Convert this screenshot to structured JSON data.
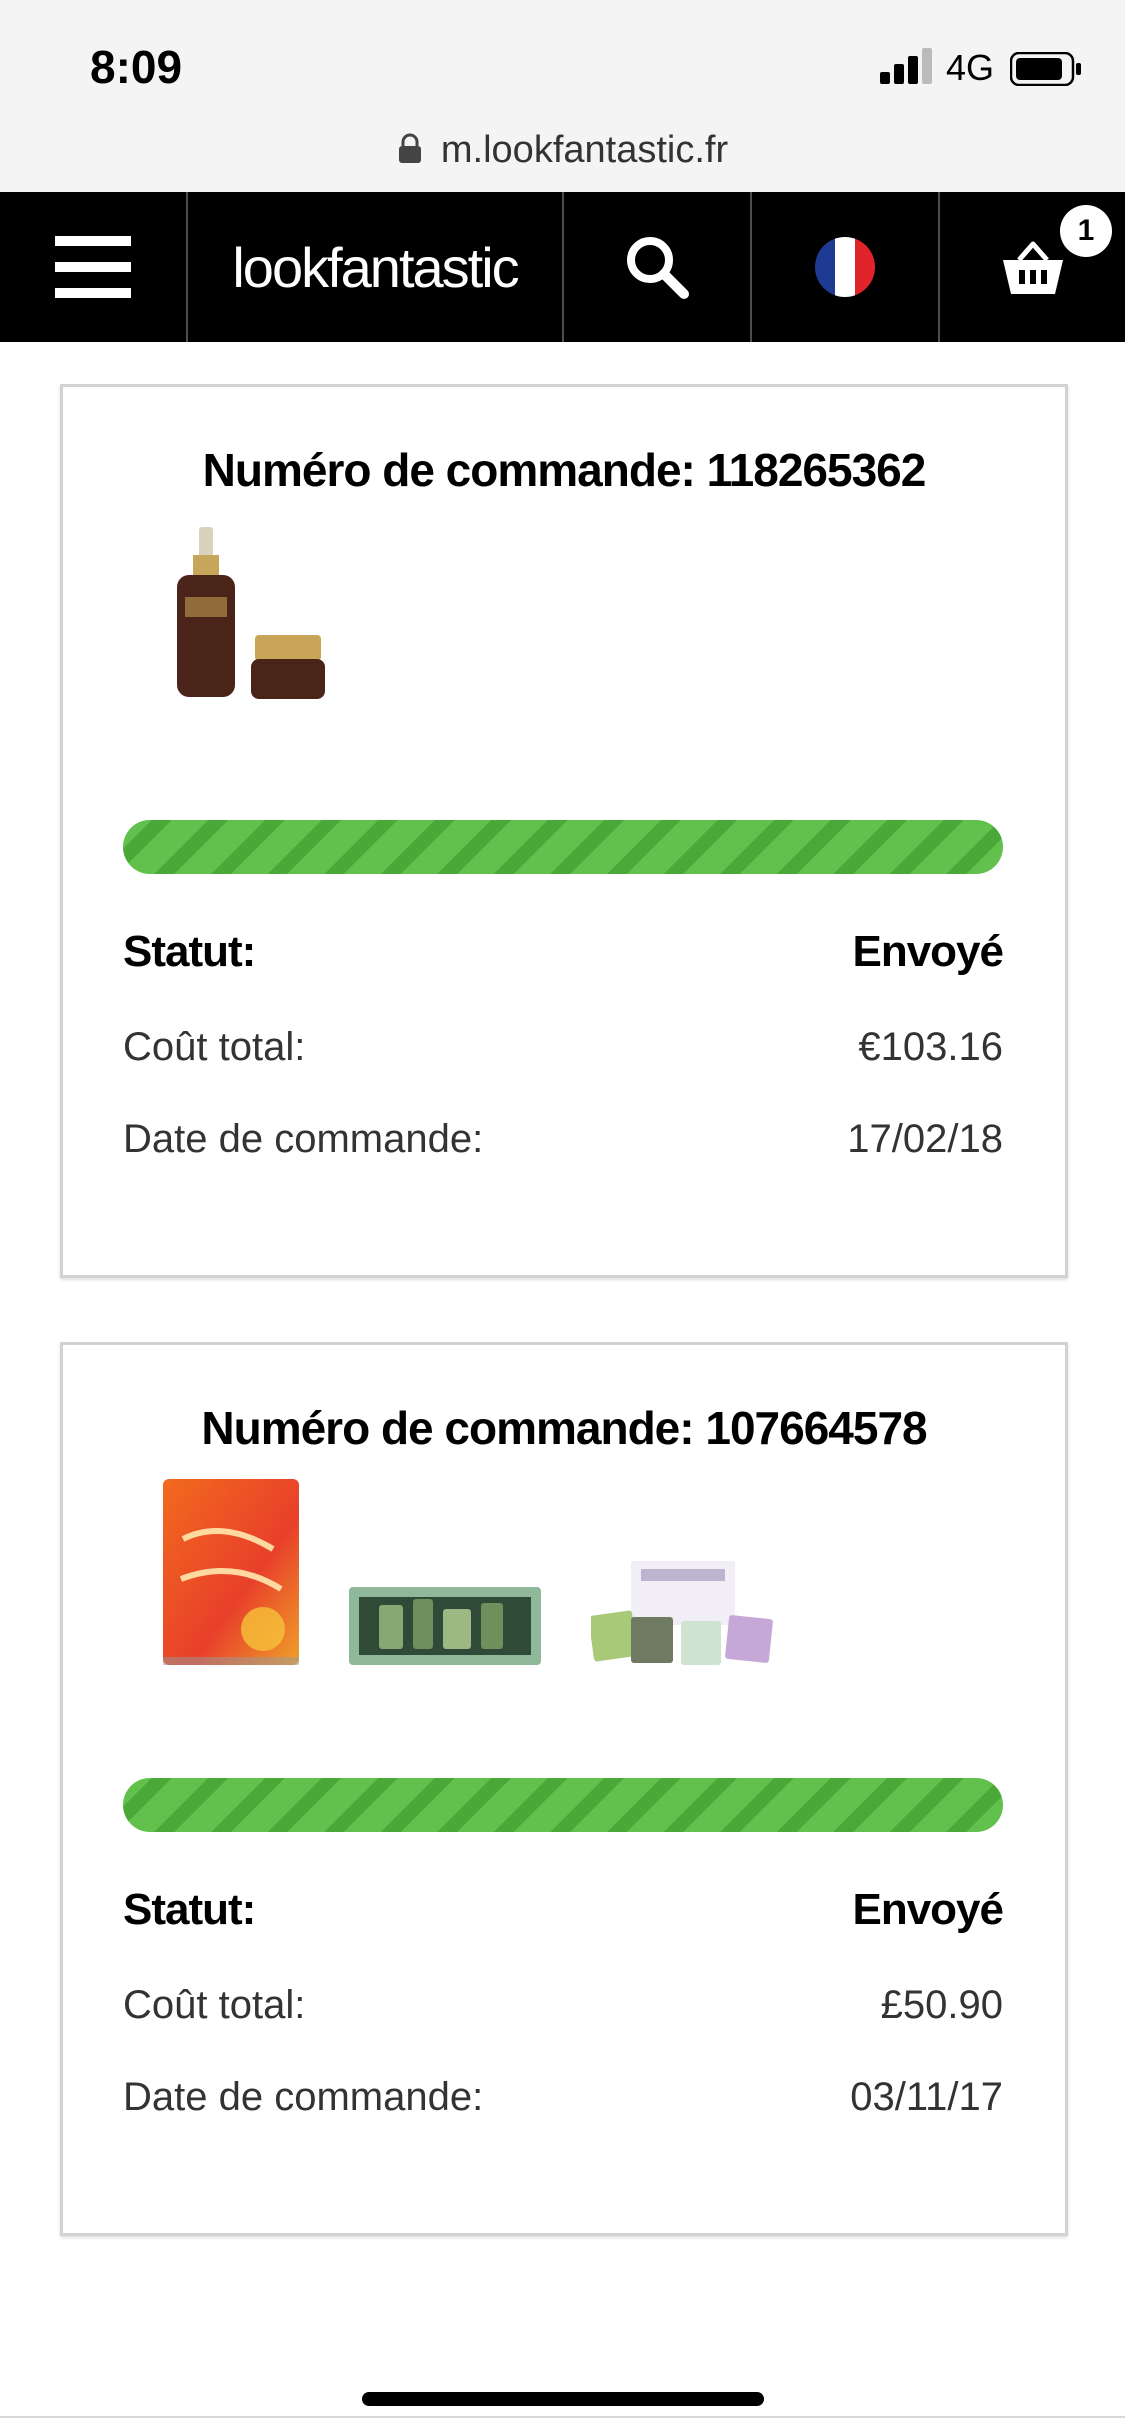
{
  "status_bar": {
    "time": "8:09",
    "network": "4G",
    "url": "m.lookfantastic.fr"
  },
  "header": {
    "logo_text": "lookfantastic",
    "basket_count": "1",
    "icons": [
      "menu-icon",
      "search-icon",
      "france-flag-icon",
      "basket-icon"
    ]
  },
  "orders": [
    {
      "title": "Numéro de commande: 118265362",
      "products": [
        "serum-bottle-and-eye-cream",
        "",
        ""
      ],
      "progress": 1.0,
      "status_label": "Statut:",
      "status_value": "Envoyé",
      "total_label": "Coût total:",
      "total_value": "€103.16",
      "date_label": "Date de commande:",
      "date_value": "17/02/18"
    },
    {
      "title": "Numéro de commande: 107664578",
      "products": [
        "flower-fusion-mask",
        "gift-set-box",
        "sheet-mask-set"
      ],
      "progress": 1.0,
      "status_label": "Statut:",
      "status_value": "Envoyé",
      "total_label": "Coût total:",
      "total_value": "£50.90",
      "date_label": "Date de commande:",
      "date_value": "03/11/17"
    }
  ],
  "colors": {
    "header_bg": "#000000",
    "progress_green": "#5cbc47",
    "progress_stripe": "#47a536",
    "card_border": "#d2d2d2"
  }
}
